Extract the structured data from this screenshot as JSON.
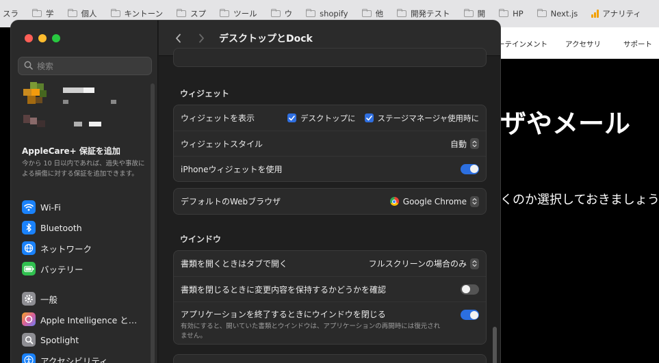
{
  "browser": {
    "bookmarks": [
      {
        "label": "スラ",
        "icon": "none"
      },
      {
        "label": "学",
        "icon": "folder"
      },
      {
        "label": "個人",
        "icon": "folder"
      },
      {
        "label": "キントーン",
        "icon": "folder"
      },
      {
        "label": "スプ",
        "icon": "folder"
      },
      {
        "label": "ツール",
        "icon": "folder"
      },
      {
        "label": "ウ",
        "icon": "folder"
      },
      {
        "label": "shopify",
        "icon": "folder"
      },
      {
        "label": "他",
        "icon": "folder"
      },
      {
        "label": "開発テスト",
        "icon": "folder"
      },
      {
        "label": "開",
        "icon": "folder"
      },
      {
        "label": "HP",
        "icon": "folder"
      },
      {
        "label": "Next.js",
        "icon": "folder"
      },
      {
        "label": "アナリティ",
        "icon": "analytics"
      }
    ],
    "site_nav": [
      "ーテインメント",
      "アクセサリ",
      "サポート"
    ],
    "hero": "ザやメール",
    "subtext": "くのか選択しておきましょう。"
  },
  "window": {
    "title": "デスクトップとDock",
    "search": {
      "placeholder": "検索",
      "value": ""
    },
    "applecare": {
      "title": "AppleCare+ 保証を追加",
      "desc": "今から 10 日以内であれば、過失や事故による損傷に対する保証を追加できます。"
    },
    "sidebar": [
      {
        "label": "Wi-Fi",
        "icon": "wifi-icon",
        "color": "#1a82fb"
      },
      {
        "label": "Bluetooth",
        "icon": "bluetooth-icon",
        "color": "#1a82fb"
      },
      {
        "label": "ネットワーク",
        "icon": "globe-icon",
        "color": "#1a82fb"
      },
      {
        "label": "バッテリー",
        "icon": "battery-icon",
        "color": "#30c04f"
      },
      {
        "label": "一般",
        "icon": "gear-icon",
        "color": "#8e8e93"
      },
      {
        "label": "Apple Intelligence と…",
        "icon": "apple-intelligence-icon",
        "color": "#d9609a"
      },
      {
        "label": "Spotlight",
        "icon": "magnifier-icon",
        "color": "#8e8e93"
      },
      {
        "label": "アクセシビリティ",
        "icon": "accessibility-icon",
        "color": "#1a82fb"
      }
    ],
    "widgets": {
      "heading": "ウィジェット",
      "show_label": "ウィジェットを表示",
      "show_desktop": "デスクトップに",
      "show_stage": "ステージマネージャ使用時に",
      "style_label": "ウィジェットスタイル",
      "style_value": "自動",
      "iphone_label": "iPhoneウィジェットを使用",
      "iphone_on": true
    },
    "browser_default": {
      "label": "デフォルトのWebブラウザ",
      "value": "Google Chrome"
    },
    "windows": {
      "heading": "ウインドウ",
      "tabs_label": "書類を開くときはタブで開く",
      "tabs_value": "フルスクリーンの場合のみ",
      "keep_label": "書類を閉じるときに変更内容を保持するかどうかを確認",
      "keep_on": false,
      "close_label": "アプリケーションを終了するときにウインドウを閉じる",
      "close_desc": "有効にすると、開いていた書類とウインドウは、アプリケーションの再開時には復元されません。",
      "close_on": true
    }
  }
}
